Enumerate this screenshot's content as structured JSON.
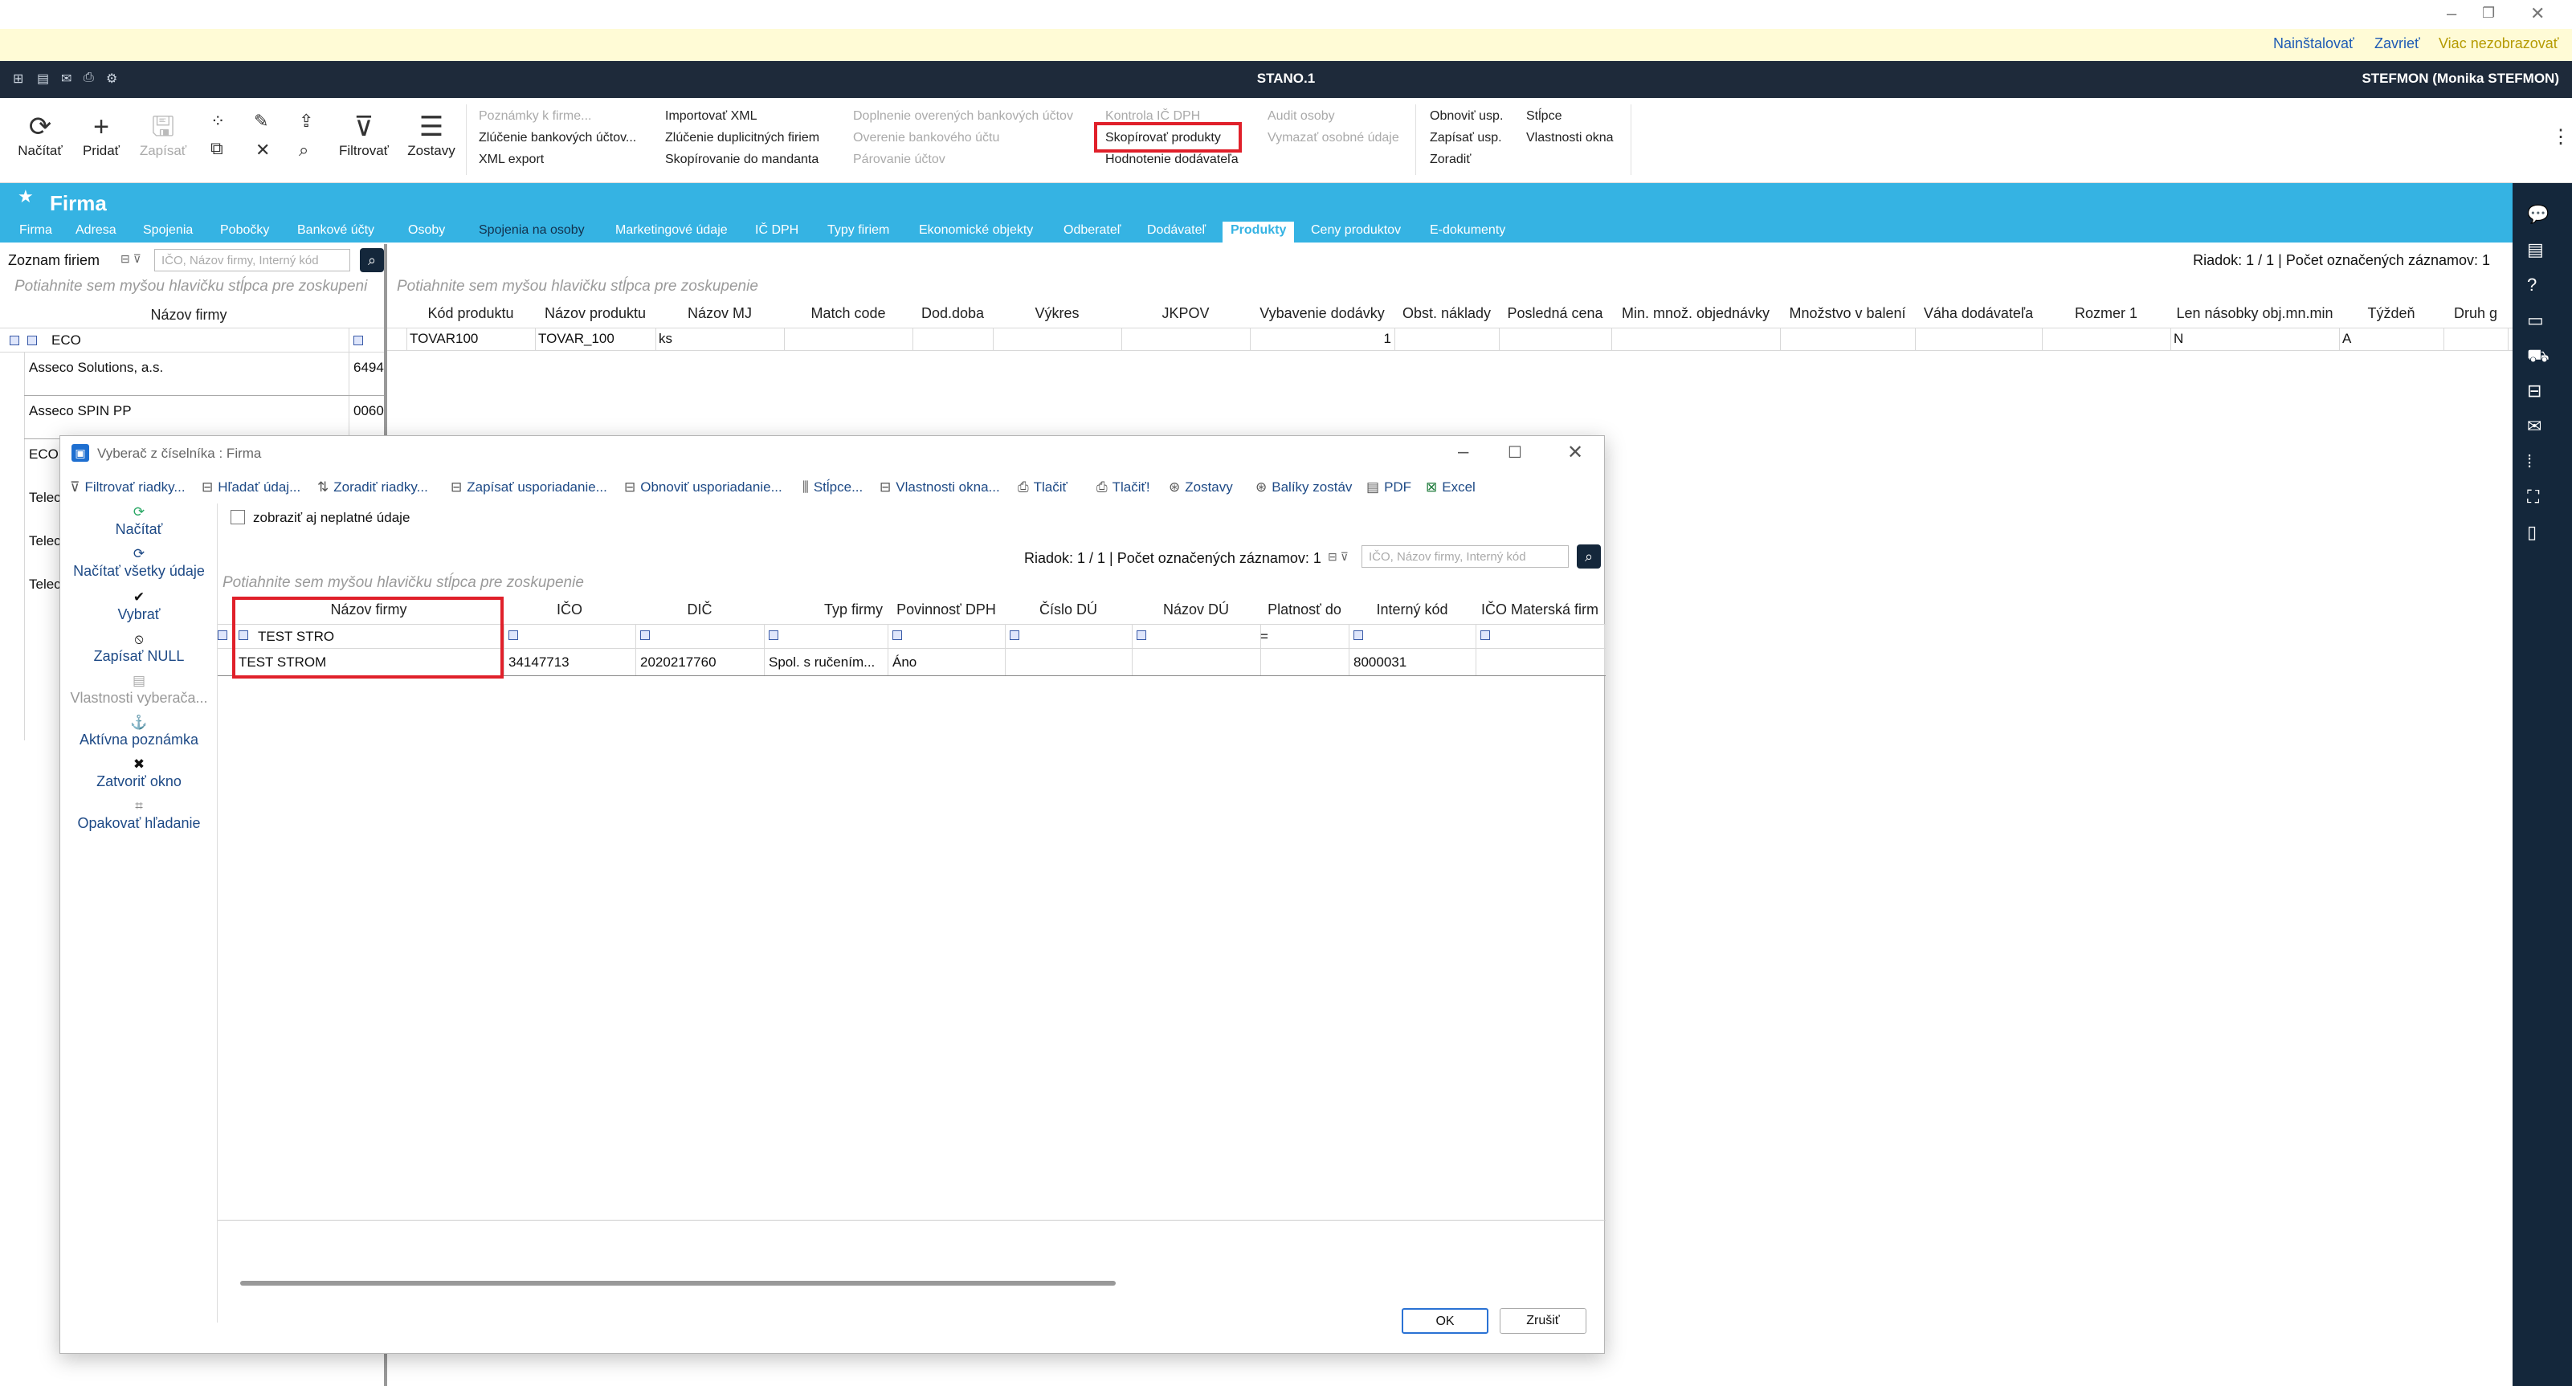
{
  "notify": {
    "install": "Nainštalovať",
    "close": "Zavrieť",
    "no_more": "Viac nezobrazovať"
  },
  "titlebar": {
    "title": "STANO.1",
    "user": "STEFMON (Monika STEFMON)"
  },
  "ribbon": {
    "buttons": {
      "load": "Načítať",
      "add": "Pridať",
      "save": "Zapísať",
      "filter": "Filtrovať",
      "reports": "Zostavy"
    },
    "col1": [
      "Poznámky k firme...",
      "Zlúčenie bankových účtov...",
      "XML export"
    ],
    "col2": [
      "Importovať XML",
      "Zlúčenie duplicitných firiem",
      "Skopírovanie do mandanta"
    ],
    "col3": [
      "Doplnenie overených bankových účtov",
      "Overenie bankového účtu",
      "Párovanie účtov"
    ],
    "col4": [
      "Kontrola IČ DPH",
      "Skopírovať produkty",
      "Hodnotenie dodávateľa"
    ],
    "col5": [
      "Audit osoby",
      "Vymazať osobné údaje"
    ],
    "col6": [
      "Obnoviť usp.",
      "Zapísať usp.",
      "Zoradiť"
    ],
    "col7": [
      "Stĺpce",
      "Vlastnosti okna"
    ]
  },
  "module": {
    "title": "Firma",
    "tabs": [
      "Firma",
      "Adresa",
      "Spojenia",
      "Pobočky",
      "Bankové účty",
      "Osoby",
      "Spojenia na osoby",
      "Marketingové údaje",
      "IČ DPH",
      "Typy firiem",
      "Ekonomické objekty",
      "Odberateľ",
      "Dodávateľ",
      "Produkty",
      "Ceny produktov",
      "E-dokumenty"
    ]
  },
  "left_list": {
    "label": "Zoznam firiem",
    "search_placeholder": "IČO, Názov firmy, Interný kód",
    "group_hint": "Potiahnite sem myšou hlavičku stĺpca pre zoskupeni",
    "col_header": "Názov firmy",
    "filter_value": "ECO",
    "rows": [
      {
        "name": "Asseco Solutions, a.s.",
        "code": "6494"
      },
      {
        "name": "Asseco SPIN PP",
        "code": "0060"
      },
      {
        "name": "ECO",
        "code": ""
      },
      {
        "name": "Telec",
        "code": ""
      },
      {
        "name": "Telec",
        "code": ""
      },
      {
        "name": "Telec",
        "code": ""
      }
    ]
  },
  "products": {
    "status": "Riadok: 1 / 1 | Počet označených záznamov: 1",
    "group_hint": "Potiahnite sem myšou hlavičku stĺpca pre zoskupenie",
    "columns": [
      "Kód produktu",
      "Názov produktu",
      "Názov MJ",
      "Match code",
      "Dod.doba",
      "Výkres",
      "JKPOV",
      "Vybavenie dodávky",
      "Obst. náklady",
      "Posledná cena",
      "Min. množ. objednávky",
      "Množstvo v balení",
      "Váha dodávateľa",
      "Rozmer 1",
      "Len násobky obj.mn.min",
      "Týždeň",
      "Druh g"
    ],
    "row": [
      "TOVAR100",
      "TOVAR_100",
      "ks",
      "",
      "",
      "",
      "",
      "1",
      "",
      "",
      "",
      "",
      "",
      "",
      "N",
      "A",
      ""
    ]
  },
  "dialog": {
    "title": "Vyberač z číselníka : Firma",
    "toolbar": [
      "Filtrovať riadky...",
      "Hľadať údaj...",
      "Zoradiť riadky...",
      "Zapísať usporiadanie...",
      "Obnoviť usporiadanie...",
      "Stĺpce...",
      "Vlastnosti okna...",
      "Tlačiť",
      "Tlačiť!",
      "Zostavy",
      "Balíky zostáv",
      "PDF",
      "Excel"
    ],
    "side": [
      "Načítať",
      "Načítať všetky údaje",
      "Vybrať",
      "Zapísať NULL",
      "Vlastnosti vyberača...",
      "Aktívna poznámka",
      "Zatvoriť okno",
      "Opakovať hľadanie"
    ],
    "checkbox": "zobraziť aj neplatné údaje",
    "status": "Riadok: 1 / 1 | Počet označených záznamov: 1",
    "search_placeholder": "IČO, Názov firmy, Interný kód",
    "group_hint": "Potiahnite sem myšou hlavičku stĺpca pre zoskupenie",
    "columns": [
      "Názov firmy",
      "IČO",
      "DIČ",
      "Typ firmy",
      "Povinnosť DPH",
      "Číslo DÚ",
      "Názov DÚ",
      "Platnosť do",
      "Interný kód",
      "IČO Materská firm"
    ],
    "filter_value": "TEST STRO",
    "filter_eq": "=",
    "row": [
      "TEST STROM",
      "34147713",
      "2020217760",
      "Spol. s ručením...",
      "Áno",
      "",
      "",
      "",
      "8000031",
      ""
    ],
    "ok": "OK",
    "cancel": "Zrušiť"
  }
}
